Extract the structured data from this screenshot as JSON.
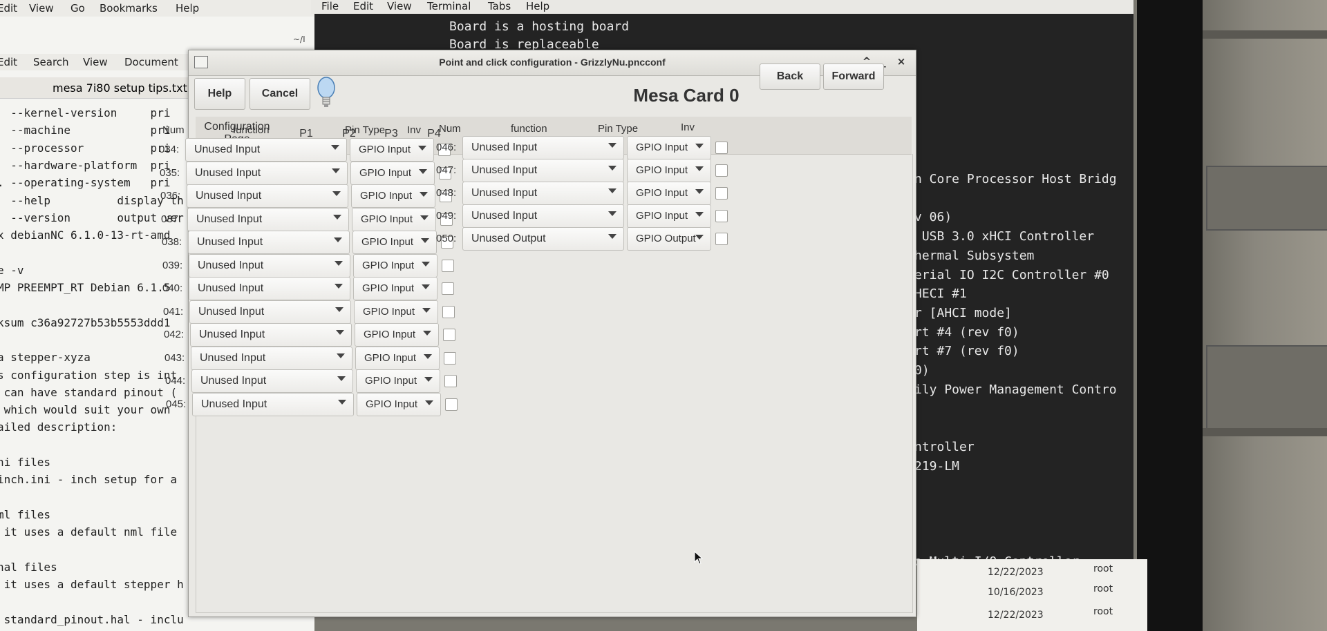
{
  "editor_file_manager": {
    "menu": [
      "Edit",
      "View",
      "Go",
      "Bookmarks",
      "Help"
    ],
    "path_fragment": "~/I"
  },
  "editor": {
    "menu": [
      "Edit",
      "Search",
      "View",
      "Document"
    ],
    "tab_title": "mesa 7i80 setup tips.txt",
    "lines": [
      "  --kernel-version     pri",
      "  --machine            pri",
      "  --processor          pri",
      "  --hardware-platform  pri",
      ". --operating-system   pri",
      "  --help          display th",
      "  --version       output ver",
      "x debianNC 6.1.0-13-rt-amd",
      "",
      "e -v",
      "MP PREEMPT_RT Debian 6.1.5",
      "",
      "ksum c36a92727b53b5553ddd1",
      "",
      "a stepper-xyza",
      "s configuration step is int",
      " can have standard pinout (",
      " which would suit your own",
      "ailed description:",
      "",
      "ni files",
      "inch.ini - inch setup for a",
      "",
      "ml files",
      " it uses a default nml file",
      "",
      "hal files",
      " it uses a default stepper h",
      "",
      " standard_pinout.hal - inclu"
    ]
  },
  "terminal": {
    "menu": [
      "File",
      "Edit",
      "View",
      "Terminal",
      "Tabs",
      "Help"
    ],
    "top_lines": [
      "Board is a hosting board",
      "Board is replaceable"
    ],
    "right_lines": [
      "n Core Processor Host Bridg",
      "",
      "v 06)",
      " USB 3.0 xHCI Controller",
      "hermal Subsystem",
      "erial IO I2C Controller #0",
      "HECI #1",
      "r [AHCI mode]",
      "rt #4 (rev f0)",
      "rt #7 (rev f0)",
      "0)",
      "ily Power Management Contro",
      "",
      "",
      "ntroller",
      "219-LM",
      "",
      "",
      "",
      "",
      "o Multi I/O Controller"
    ]
  },
  "file_list": [
    {
      "date": "12/22/2023",
      "owner": "root"
    },
    {
      "date": "10/16/2023",
      "owner": "root"
    },
    {
      "date": "12/22/2023",
      "owner": "root"
    }
  ],
  "dialog": {
    "title": "Point and click configuration - GrizzlyNu.pncconf",
    "title_controls": [
      "^",
      "_",
      "×"
    ],
    "help_label": "Help",
    "cancel_label": "Cancel",
    "heading": "Mesa Card 0",
    "back_label": "Back",
    "forward_label": "Forward",
    "tabs": [
      "Configuration\nPage",
      "P1",
      "P2",
      "P3",
      "P4"
    ],
    "active_tab": "P3",
    "headers": {
      "num": "Num",
      "function": "function",
      "pin_type": "Pin Type",
      "inv": "Inv"
    },
    "left_pins": [
      {
        "num": "034:",
        "function": "Unused Input",
        "pin_type": "GPIO Input"
      },
      {
        "num": "035:",
        "function": "Unused Input",
        "pin_type": "GPIO Input"
      },
      {
        "num": "036:",
        "function": "Unused Input",
        "pin_type": "GPIO Input"
      },
      {
        "num": "037:",
        "function": "Unused Input",
        "pin_type": "GPIO Input"
      },
      {
        "num": "038:",
        "function": "Unused Input",
        "pin_type": "GPIO Input"
      },
      {
        "num": "039:",
        "function": "Unused Input",
        "pin_type": "GPIO Input"
      },
      {
        "num": "040:",
        "function": "Unused Input",
        "pin_type": "GPIO Input"
      },
      {
        "num": "041:",
        "function": "Unused Input",
        "pin_type": "GPIO Input"
      },
      {
        "num": "042:",
        "function": "Unused Input",
        "pin_type": "GPIO Input"
      },
      {
        "num": "043:",
        "function": "Unused Input",
        "pin_type": "GPIO Input"
      },
      {
        "num": "044:",
        "function": "Unused Input",
        "pin_type": "GPIO Input"
      },
      {
        "num": "045:",
        "function": "Unused Input",
        "pin_type": "GPIO Input"
      }
    ],
    "right_pins": [
      {
        "num": "046:",
        "function": "Unused Input",
        "pin_type": "GPIO Input"
      },
      {
        "num": "047:",
        "function": "Unused Input",
        "pin_type": "GPIO Input"
      },
      {
        "num": "048:",
        "function": "Unused Input",
        "pin_type": "GPIO Input"
      },
      {
        "num": "049:",
        "function": "Unused Input",
        "pin_type": "GPIO Input"
      },
      {
        "num": "050:",
        "function": "Unused Output",
        "pin_type": "GPIO Output"
      }
    ]
  }
}
